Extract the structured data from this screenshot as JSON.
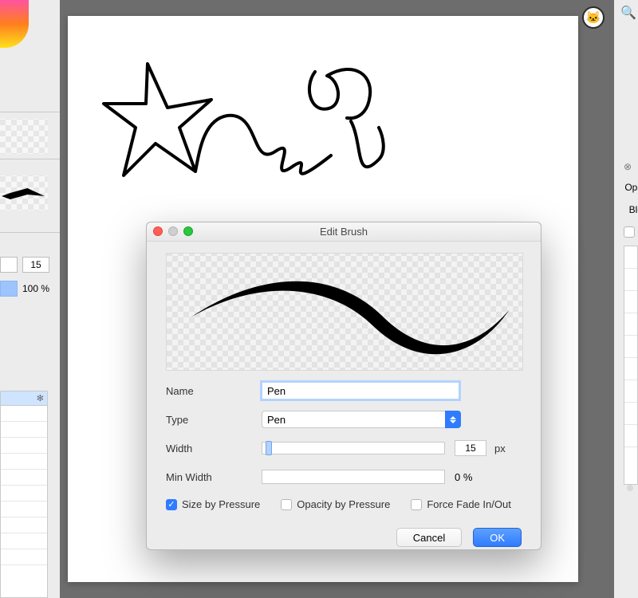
{
  "left": {
    "size_value": "15",
    "opacity_value": "100 %"
  },
  "right": {
    "label1": "Opa",
    "label2": "Ble"
  },
  "dialog": {
    "title": "Edit Brush",
    "name_label": "Name",
    "name_value": "Pen",
    "type_label": "Type",
    "type_value": "Pen",
    "width_label": "Width",
    "width_value": "15",
    "width_unit": "px",
    "minwidth_label": "Min Width",
    "minwidth_value": "0 %",
    "check_size": "Size by Pressure",
    "check_opacity": "Opacity by Pressure",
    "check_fade": "Force Fade In/Out",
    "cancel": "Cancel",
    "ok": "OK"
  }
}
